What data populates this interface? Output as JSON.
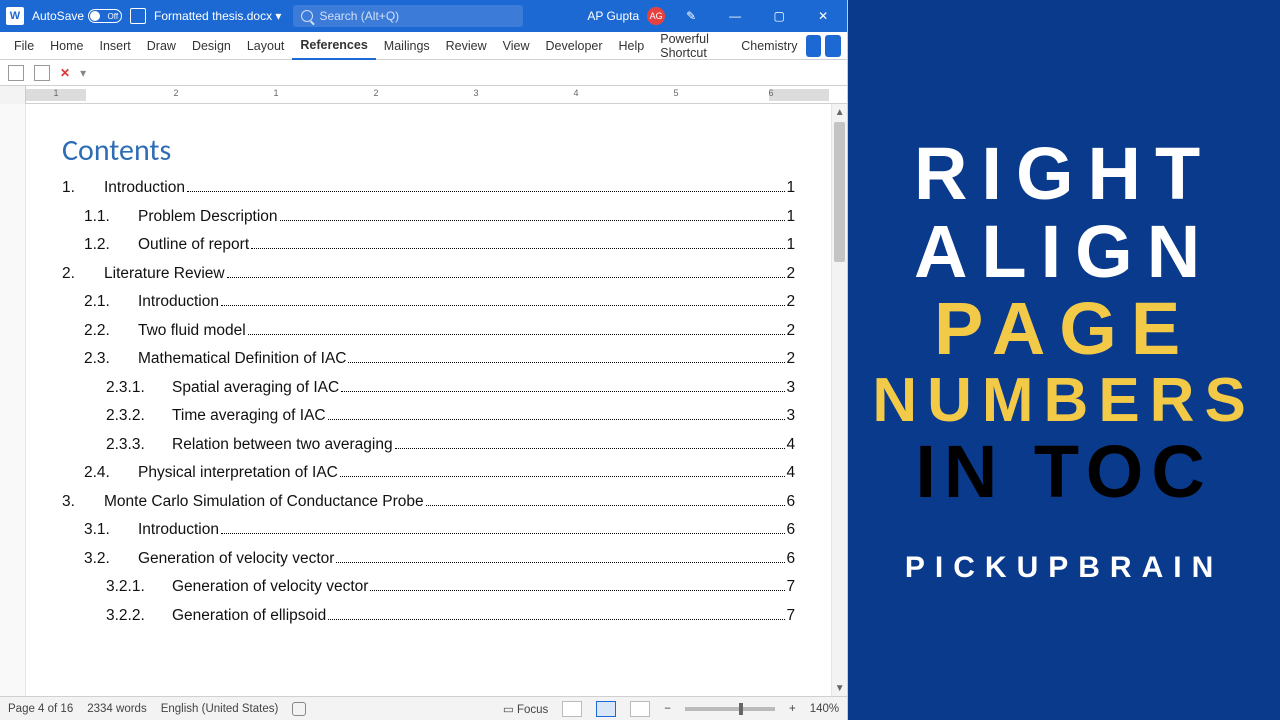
{
  "titlebar": {
    "autosave_label": "AutoSave",
    "autosave_state": "Off",
    "doc_name": "Formatted thesis.docx ▾",
    "search_placeholder": "Search (Alt+Q)",
    "user_name": "AP Gupta",
    "user_initials": "AG"
  },
  "tabs": [
    "File",
    "Home",
    "Insert",
    "Draw",
    "Design",
    "Layout",
    "References",
    "Mailings",
    "Review",
    "View",
    "Developer",
    "Help",
    "Powerful Shortcut",
    "Chemistry"
  ],
  "tabs_active": "References",
  "ruler_numbers": [
    "1",
    "2",
    "1",
    "2",
    "3",
    "4",
    "5",
    "6"
  ],
  "contents_heading": "Contents",
  "toc": [
    {
      "lvl": 1,
      "n": "1.",
      "t": "Introduction",
      "p": "1"
    },
    {
      "lvl": 2,
      "n": "1.1.",
      "t": "Problem Description",
      "p": "1"
    },
    {
      "lvl": 2,
      "n": "1.2.",
      "t": "Outline of report",
      "p": "1"
    },
    {
      "lvl": 1,
      "n": "2.",
      "t": "Literature Review",
      "p": "2"
    },
    {
      "lvl": 2,
      "n": "2.1.",
      "t": "Introduction",
      "p": "2"
    },
    {
      "lvl": 2,
      "n": "2.2.",
      "t": "Two fluid model",
      "p": "2"
    },
    {
      "lvl": 2,
      "n": "2.3.",
      "t": "Mathematical Definition of IAC",
      "p": "2"
    },
    {
      "lvl": 3,
      "n": "2.3.1.",
      "t": "Spatial averaging of IAC",
      "p": "3"
    },
    {
      "lvl": 3,
      "n": "2.3.2.",
      "t": "Time averaging of IAC",
      "p": "3"
    },
    {
      "lvl": 3,
      "n": "2.3.3.",
      "t": "Relation between two averaging",
      "p": "4"
    },
    {
      "lvl": 2,
      "n": "2.4.",
      "t": "Physical interpretation of IAC",
      "p": "4"
    },
    {
      "lvl": 1,
      "n": "3.",
      "t": "Monte Carlo Simulation of Conductance Probe",
      "p": "6"
    },
    {
      "lvl": 2,
      "n": "3.1.",
      "t": "Introduction",
      "p": "6"
    },
    {
      "lvl": 2,
      "n": "3.2.",
      "t": "Generation of velocity vector",
      "p": "6"
    },
    {
      "lvl": 3,
      "n": "3.2.1.",
      "t": "Generation of velocity vector",
      "p": "7"
    },
    {
      "lvl": 3,
      "n": "3.2.2.",
      "t": "Generation of ellipsoid",
      "p": "7"
    }
  ],
  "status": {
    "page": "Page 4 of 16",
    "words": "2334 words",
    "lang": "English (United States)",
    "focus": "Focus",
    "zoom": "140%"
  },
  "banner": {
    "l1": "RIGHT",
    "l2": "ALIGN",
    "l3": "PAGE",
    "l4": "NUMBERS",
    "l5": "IN TOC",
    "brand": "PICKUPBRAIN"
  }
}
